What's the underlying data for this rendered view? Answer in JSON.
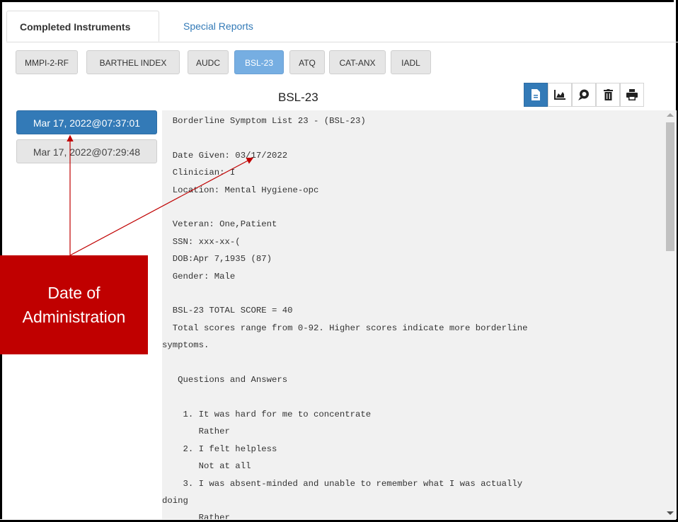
{
  "top_tabs": {
    "active": "Completed Instruments",
    "other": "Special Reports"
  },
  "instrument_tabs": [
    {
      "label": "MMPI-2-RF",
      "selected": false
    },
    {
      "label": "BARTHEL INDEX",
      "selected": false
    },
    {
      "label": "AUDC",
      "selected": false
    },
    {
      "label": "BSL-23",
      "selected": true
    },
    {
      "label": "ATQ",
      "selected": false
    },
    {
      "label": "CAT-ANX",
      "selected": false
    },
    {
      "label": "IADL",
      "selected": false
    }
  ],
  "report_title": "BSL-23",
  "toolbar": {
    "icons": [
      "report-icon",
      "chart-icon",
      "comment-icon",
      "trash-icon",
      "print-icon"
    ],
    "active_icon": "report-icon",
    "accent": "#337ab7"
  },
  "dates": [
    {
      "label": "Mar 17, 2022@07:37:01",
      "selected": true
    },
    {
      "label": "Mar 17, 2022@07:29:48",
      "selected": false
    }
  ],
  "report_lines": [
    "  Borderline Symptom List 23 - (BSL-23)",
    "",
    "  Date Given: 03/17/2022",
    "  Clinician: I",
    "  Location: Mental Hygiene-opc",
    "",
    "  Veteran: One,Patient",
    "  SSN: xxx-xx-(",
    "  DOB:Apr 7,1935 (87)",
    "  Gender: Male",
    "",
    "  BSL-23 TOTAL SCORE = 40",
    "  Total scores range from 0-92. Higher scores indicate more borderline",
    "symptoms.",
    "",
    "   Questions and Answers",
    "",
    "    1. It was hard for me to concentrate",
    "       Rather",
    "    2. I felt helpless",
    "       Not at all",
    "    3. I was absent-minded and unable to remember what I was actually",
    "doing",
    "       Rather"
  ],
  "callout": {
    "line1": "Date of",
    "line2": "Administration",
    "color": "#c00000"
  }
}
